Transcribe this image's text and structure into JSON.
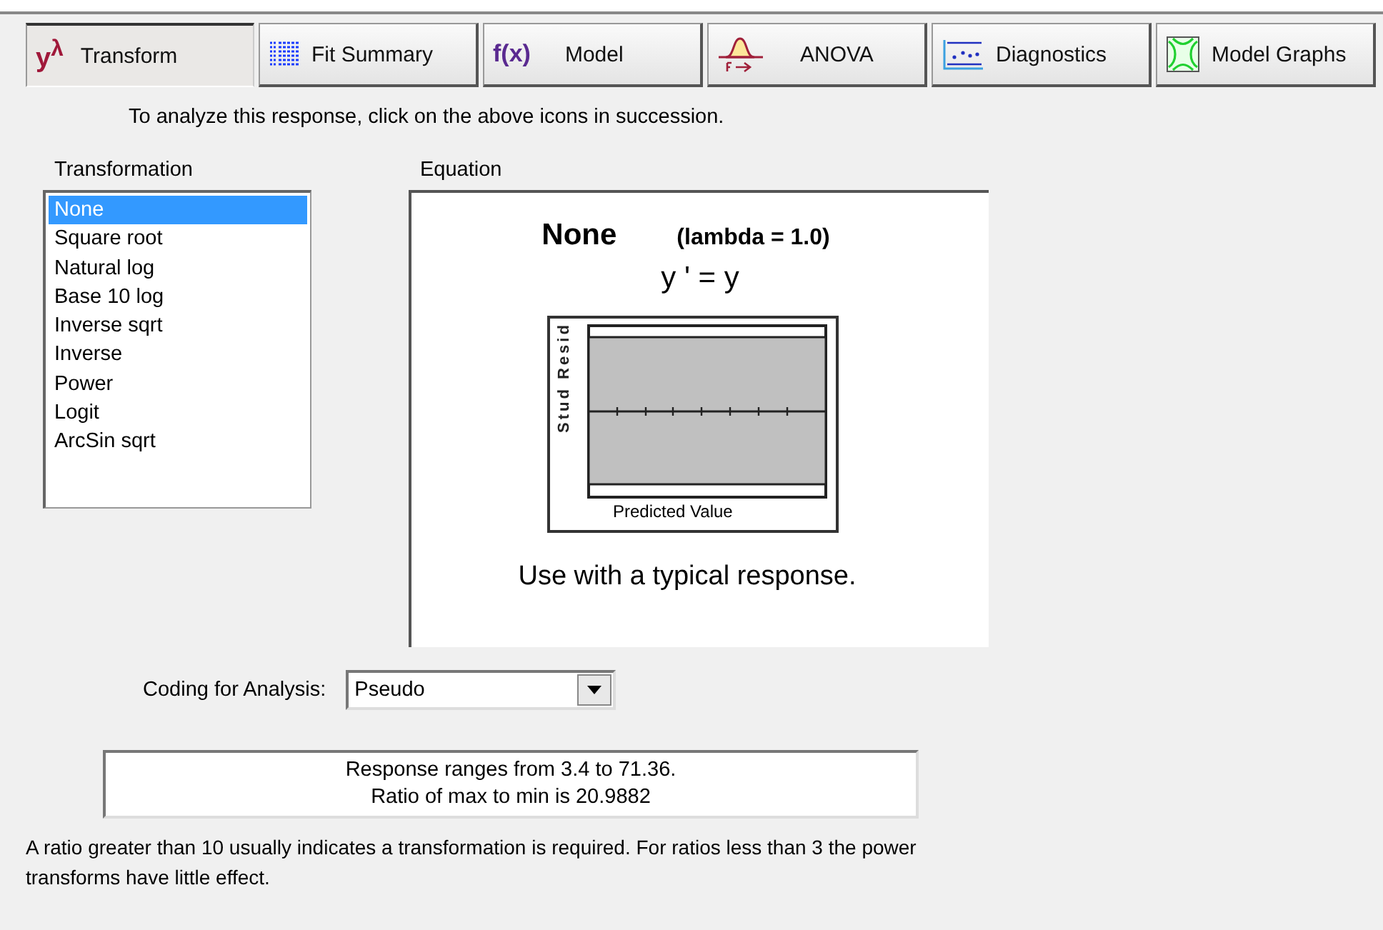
{
  "tabs": [
    {
      "label": "Transform",
      "icon": "y$^{λ}$",
      "kind": "glyph",
      "selected": true
    },
    {
      "label": "Fit Summary",
      "kind": "list",
      "selected": false
    },
    {
      "label": "Model",
      "icon": "f(x)",
      "kind": "glyph",
      "selected": false
    },
    {
      "label": "ANOVA",
      "kind": "distribution",
      "selected": false
    },
    {
      "label": "Diagnostics",
      "kind": "scatter",
      "selected": false
    },
    {
      "label": "Model Graphs",
      "kind": "contour",
      "selected": false
    }
  ],
  "hint": "To analyze this response, click on the above icons in succession.",
  "transformation": {
    "label": "Transformation",
    "items": [
      {
        "label": "None",
        "selected": true
      },
      {
        "label": "Square root",
        "selected": false
      },
      {
        "label": "Natural log",
        "selected": false
      },
      {
        "label": "Base 10 log",
        "selected": false
      },
      {
        "label": "Inverse sqrt",
        "selected": false
      },
      {
        "label": "Inverse",
        "selected": false
      },
      {
        "label": "Power",
        "selected": false
      },
      {
        "label": "Logit",
        "selected": false
      },
      {
        "label": "ArcSin sqrt",
        "selected": false
      }
    ]
  },
  "equation": {
    "label": "Equation",
    "name": "None",
    "lambda": "(lambda = 1.0)",
    "formula": "y ' = y",
    "plot": {
      "ylabel": "Stud Resid",
      "xlabel": "Predicted Value"
    },
    "note": "Use with a typical response."
  },
  "coding": {
    "label": "Coding for Analysis:",
    "value": "Pseudo"
  },
  "info": [
    "Response ranges from 3.4 to 71.36.",
    "Ratio of max to min is 20.9882"
  ],
  "footer": "A ratio greater than 10 usually indicates a transformation is required.  For ratios less than 3 the power transforms have little effect."
}
